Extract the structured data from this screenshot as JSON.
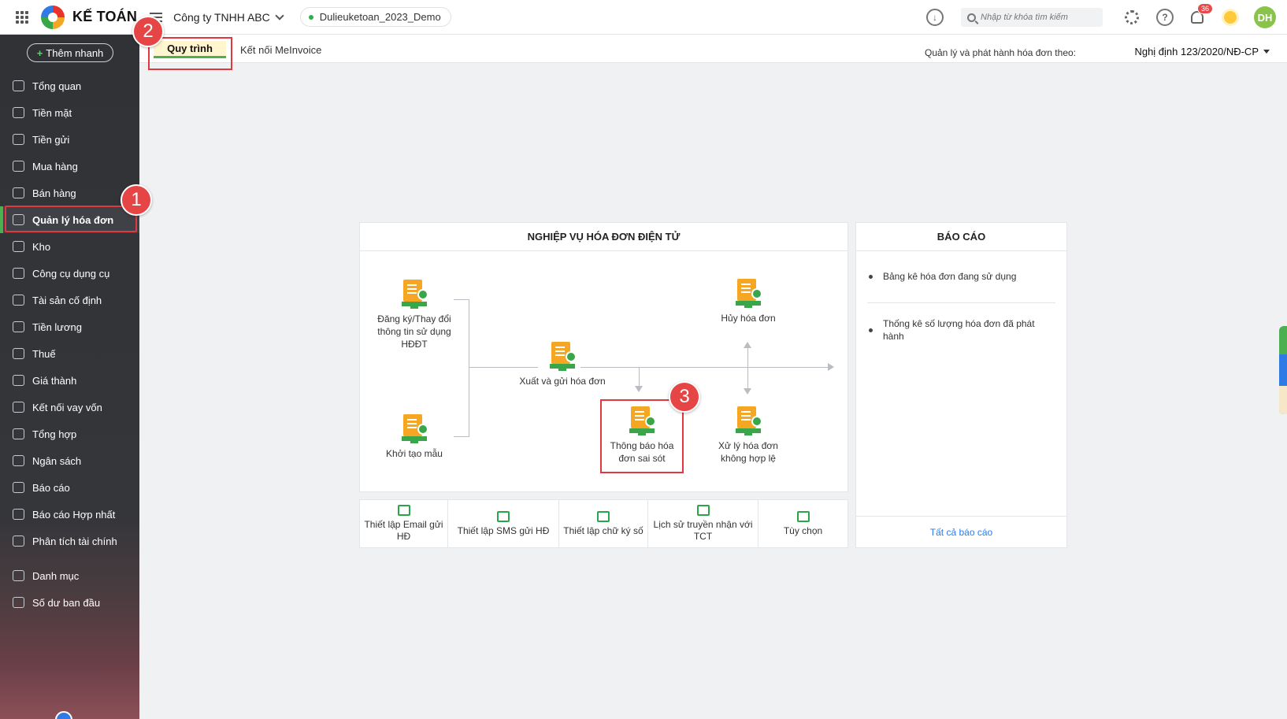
{
  "header": {
    "logo": "KẾ TOÁN",
    "company": "Công ty TNHH ABC",
    "database": "Dulieuketoan_2023_Demo",
    "search_placeholder": "Nhập từ khóa tìm kiếm",
    "notification_count": "36",
    "avatar_initials": "DH"
  },
  "sidebar": {
    "quick_add": "Thêm nhanh",
    "items": [
      {
        "label": "Tổng quan",
        "icon": "pie-chart-icon"
      },
      {
        "label": "Tiền mặt",
        "icon": "money-bag-icon"
      },
      {
        "label": "Tiền gửi",
        "icon": "bank-icon"
      },
      {
        "label": "Mua hàng",
        "icon": "shopping-bag-icon"
      },
      {
        "label": "Bán hàng",
        "icon": "cart-icon"
      },
      {
        "label": "Quản lý hóa đơn",
        "icon": "invoice-icon"
      },
      {
        "label": "Kho",
        "icon": "warehouse-icon"
      },
      {
        "label": "Công cụ dụng cụ",
        "icon": "tools-icon"
      },
      {
        "label": "Tài sản cố định",
        "icon": "car-icon"
      },
      {
        "label": "Tiền lương",
        "icon": "payroll-icon"
      },
      {
        "label": "Thuế",
        "icon": "tax-icon"
      },
      {
        "label": "Giá thành",
        "icon": "price-tag-icon"
      },
      {
        "label": "Kết nối vay vốn",
        "icon": "loan-icon"
      },
      {
        "label": "Tổng hợp",
        "icon": "summary-icon"
      },
      {
        "label": "Ngân sách",
        "icon": "budget-icon"
      },
      {
        "label": "Báo cáo",
        "icon": "bar-chart-icon"
      },
      {
        "label": "Báo cáo Hợp nhất",
        "icon": "consolidated-report-icon"
      },
      {
        "label": "Phân tích tài chính",
        "icon": "line-chart-icon"
      },
      {
        "label": "Danh mục",
        "icon": "list-icon"
      },
      {
        "label": "Số dư ban đầu",
        "icon": "opening-balance-icon"
      }
    ]
  },
  "subbar": {
    "tabs": [
      "Quy trình",
      "Kết nối MeInvoice"
    ],
    "regulation_label": "Quản lý và phát hành hóa đơn theo:",
    "regulation_value": "Nghị định 123/2020/NĐ-CP"
  },
  "steps": [
    "1",
    "2",
    "3"
  ],
  "workflow": {
    "title": "NGHIỆP VỤ HÓA ĐƠN ĐIỆN TỬ",
    "nodes": {
      "register": "Đăng ký/Thay đổi thông tin sử dụng HĐĐT",
      "template": "Khởi tạo mẫu",
      "issue": "Xuất và gửi hóa đơn",
      "cancel": "Hủy hóa đơn",
      "error_notice": "Thông báo hóa đơn sai sót",
      "invalid": "Xử lý hóa đơn không hợp lệ"
    },
    "tools": [
      "Thiết lập Email gửi HĐ",
      "Thiết lập SMS gửi HĐ",
      "Thiết lập chữ ký số",
      "Lịch sử truyền nhận với TCT",
      "Tùy chọn"
    ]
  },
  "reports": {
    "title": "BÁO CÁO",
    "items": [
      "Bảng kê hóa đơn đang sử dụng",
      "Thống kê số lượng hóa đơn đã phát hành"
    ],
    "all_link": "Tất cả báo cáo"
  },
  "colors": {
    "accent_green": "#4caf50",
    "highlight_red": "#e0383e",
    "link_blue": "#2f7be5",
    "sidebar_bg": "#303236"
  }
}
